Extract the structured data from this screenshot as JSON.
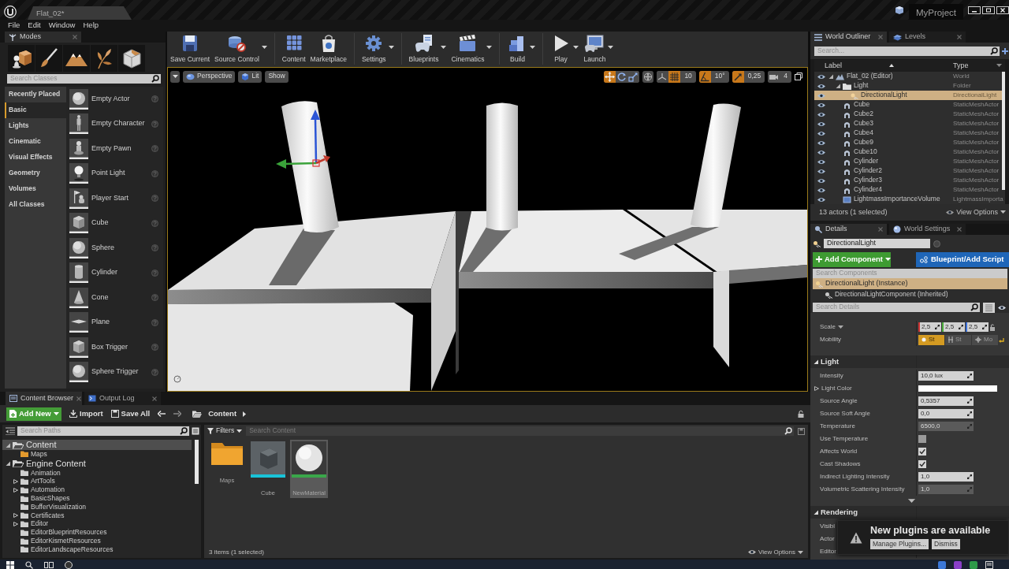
{
  "title_bar": {
    "tabs": [
      {
        "label": "Flat_02*",
        "selected": true
      }
    ],
    "project": "MyProject"
  },
  "menu_bar": [
    "File",
    "Edit",
    "Window",
    "Help"
  ],
  "modes_panel": {
    "tab": "Modes",
    "mode_tools": [
      {
        "kind": "place"
      },
      {
        "kind": "paint"
      },
      {
        "kind": "landscape"
      },
      {
        "kind": "foliage"
      },
      {
        "kind": "geometry"
      }
    ],
    "search": {
      "placeholder": "Search Classes"
    },
    "categories": [
      {
        "label": "Recently Placed",
        "selected": false
      },
      {
        "label": "Basic",
        "selected": true
      },
      {
        "label": "Lights",
        "selected": false
      },
      {
        "label": "Cinematic",
        "selected": false
      },
      {
        "label": "Visual Effects",
        "selected": false
      },
      {
        "label": "Geometry",
        "selected": false
      },
      {
        "label": "Volumes",
        "selected": false
      },
      {
        "label": "All Classes",
        "selected": false
      }
    ],
    "items": [
      {
        "label": "Empty Actor",
        "kind": "sphere"
      },
      {
        "label": "Empty Character",
        "kind": "character"
      },
      {
        "label": "Empty Pawn",
        "kind": "pawn"
      },
      {
        "label": "Point Light",
        "kind": "bulb"
      },
      {
        "label": "Player Start",
        "kind": "flag"
      },
      {
        "label": "Cube",
        "kind": "cube"
      },
      {
        "label": "Sphere",
        "kind": "sphere"
      },
      {
        "label": "Cylinder",
        "kind": "cylinder"
      },
      {
        "label": "Cone",
        "kind": "cone"
      },
      {
        "label": "Plane",
        "kind": "plane"
      },
      {
        "label": "Box Trigger",
        "kind": "cube"
      },
      {
        "label": "Sphere Trigger",
        "kind": "sphere"
      }
    ]
  },
  "toolbar": [
    {
      "label": "Save Current",
      "kind": "save",
      "dropdown": false
    },
    {
      "label": "Source Control",
      "kind": "source_control",
      "dropdown": true
    },
    {
      "label": "Content",
      "kind": "content",
      "dropdown": false
    },
    {
      "label": "Marketplace",
      "kind": "marketplace",
      "dropdown": false
    },
    {
      "label": "Settings",
      "kind": "settings",
      "dropdown": true
    },
    {
      "label": "Blueprints",
      "kind": "blueprints",
      "dropdown": true
    },
    {
      "label": "Cinematics",
      "kind": "cinematics",
      "dropdown": true
    },
    {
      "label": "Build",
      "kind": "build",
      "dropdown": true
    },
    {
      "label": "Play",
      "kind": "play",
      "dropdown": true
    },
    {
      "label": "Launch",
      "kind": "launch",
      "dropdown": true
    }
  ],
  "viewport": {
    "view_buttons": [
      {
        "label": "Perspective",
        "kind": "perspective"
      },
      {
        "label": "Lit",
        "kind": "lit"
      },
      {
        "label": "Show",
        "kind": "plain"
      }
    ],
    "transform_tools": [
      {
        "kind": "move",
        "selected": true
      },
      {
        "kind": "rotate",
        "selected": false
      },
      {
        "kind": "scale",
        "selected": false
      }
    ],
    "snaps": [
      {
        "kind": "grid",
        "on": true,
        "value": "10"
      },
      {
        "kind": "rotation",
        "on": true,
        "value": "10°"
      },
      {
        "kind": "scale",
        "on": true,
        "value": "0,25"
      }
    ],
    "camera_speed": "4"
  },
  "world_outliner": {
    "tabs": [
      {
        "label": "World Outliner",
        "selected": true
      },
      {
        "label": "Levels",
        "selected": false
      }
    ],
    "search": {
      "placeholder": "Search..."
    },
    "columns": [
      "Label",
      "Type"
    ],
    "rows": [
      {
        "label": "Flat_02 (Editor)",
        "type": "World",
        "kind": "world",
        "selected": false,
        "expanded": true,
        "children": [
          {
            "label": "Light",
            "type": "Folder",
            "kind": "folder",
            "selected": false,
            "expanded": true,
            "children": [
              {
                "label": "DirectionalLight",
                "type": "DirectionalLight",
                "kind": "light",
                "selected": true
              }
            ]
          },
          {
            "label": "Cube",
            "type": "StaticMeshActor",
            "kind": "mesh",
            "selected": false
          },
          {
            "label": "Cube2",
            "type": "StaticMeshActor",
            "kind": "mesh",
            "selected": false
          },
          {
            "label": "Cube3",
            "type": "StaticMeshActor",
            "kind": "mesh",
            "selected": false
          },
          {
            "label": "Cube4",
            "type": "StaticMeshActor",
            "kind": "mesh",
            "selected": false
          },
          {
            "label": "Cube9",
            "type": "StaticMeshActor",
            "kind": "mesh",
            "selected": false
          },
          {
            "label": "Cube10",
            "type": "StaticMeshActor",
            "kind": "mesh",
            "selected": false
          },
          {
            "label": "Cylinder",
            "type": "StaticMeshActor",
            "kind": "mesh",
            "selected": false
          },
          {
            "label": "Cylinder2",
            "type": "StaticMeshActor",
            "kind": "mesh",
            "selected": false
          },
          {
            "label": "Cylinder3",
            "type": "StaticMeshActor",
            "kind": "mesh",
            "selected": false
          },
          {
            "label": "Cylinder4",
            "type": "StaticMeshActor",
            "kind": "mesh",
            "selected": false
          },
          {
            "label": "LightmassImportanceVolume",
            "type": "LightmassImporta",
            "kind": "volume",
            "selected": false
          }
        ]
      }
    ],
    "footer": "13 actors (1 selected)",
    "view_options": "View Options"
  },
  "details": {
    "tabs": [
      {
        "label": "Details",
        "selected": true
      },
      {
        "label": "World Settings",
        "selected": false
      }
    ],
    "name": "DirectionalLight",
    "add_component": "Add Component",
    "blueprint_button": "Blueprint/Add Script",
    "components_search": {
      "placeholder": "Search Components"
    },
    "components": [
      {
        "label": "DirectionalLight (Instance)",
        "selected": true,
        "children": [
          {
            "label": "DirectionalLightComponent (Inherited)",
            "selected": false
          }
        ]
      }
    ],
    "details_search": {
      "placeholder": "Search Details"
    },
    "transform": [
      {
        "label": "Scale",
        "kind": "vector",
        "values": [
          "2,5",
          "2,5",
          "2,5"
        ]
      },
      {
        "label": "Mobility",
        "kind": "mobility",
        "options": [
          {
            "label": "St",
            "selected": true
          },
          {
            "label": "St",
            "selected": false
          },
          {
            "label": "Mo",
            "selected": false
          }
        ]
      }
    ],
    "sections": [
      {
        "title": "Light",
        "expanded": true,
        "rows": [
          {
            "label": "Intensity",
            "kind": "number",
            "value": "10,0 lux",
            "disabled": false
          },
          {
            "label": "Light Color",
            "kind": "color",
            "color": "#ffffff",
            "expanded": false
          },
          {
            "label": "Source Angle",
            "kind": "number",
            "value": "0,5357",
            "disabled": false
          },
          {
            "label": "Source Soft Angle",
            "kind": "number",
            "value": "0,0",
            "disabled": false
          },
          {
            "label": "Temperature",
            "kind": "number",
            "value": "6500,0",
            "disabled": true
          },
          {
            "label": "Use Temperature",
            "kind": "checkbox",
            "checked": false
          },
          {
            "label": "Affects World",
            "kind": "checkbox",
            "checked": true
          },
          {
            "label": "Cast Shadows",
            "kind": "checkbox",
            "checked": true
          },
          {
            "label": "Indirect Lighting Intensity",
            "kind": "number",
            "value": "1,0",
            "disabled": false
          },
          {
            "label": "Volumetric Scattering Intensity",
            "kind": "number",
            "value": "1,0",
            "disabled": true
          }
        ]
      },
      {
        "title": "Rendering",
        "expanded": true,
        "rows": [
          {
            "label": "Visibl"
          },
          {
            "label": "Actor"
          },
          {
            "label": "Editor"
          }
        ]
      }
    ]
  },
  "notification": {
    "title": "New plugins are available",
    "buttons": [
      "Manage Plugins...",
      "Dismiss"
    ]
  },
  "content_browser": {
    "tabs": [
      {
        "label": "Content Browser",
        "selected": true
      },
      {
        "label": "Output Log",
        "selected": false
      }
    ],
    "add_new": "Add New",
    "import": "Import",
    "save_all": "Save All",
    "path": [
      "Content"
    ],
    "sources_search": {
      "placeholder": "Search Paths"
    },
    "tree": [
      {
        "label": "Content",
        "selected": true,
        "expanded": true,
        "color": "#d6d6d6",
        "children": [
          {
            "label": "Maps",
            "selected": false,
            "color": "#e39a2d"
          }
        ]
      },
      {
        "label": "Engine Content",
        "selected": false,
        "expanded": true,
        "color": "#d6d6d6",
        "children": [
          {
            "label": "Animation",
            "selected": false,
            "color": "#cfcfcf"
          },
          {
            "label": "ArtTools",
            "selected": false,
            "expanded": false,
            "color": "#cfcfcf"
          },
          {
            "label": "Automation",
            "selected": false,
            "expanded": false,
            "color": "#cfcfcf"
          },
          {
            "label": "BasicShapes",
            "selected": false,
            "color": "#cfcfcf"
          },
          {
            "label": "BufferVisualization",
            "selected": false,
            "color": "#cfcfcf"
          },
          {
            "label": "Certificates",
            "selected": false,
            "expanded": false,
            "color": "#cfcfcf"
          },
          {
            "label": "Editor",
            "selected": false,
            "expanded": false,
            "color": "#cfcfcf"
          },
          {
            "label": "EditorBlueprintResources",
            "selected": false,
            "color": "#cfcfcf"
          },
          {
            "label": "EditorKismetResources",
            "selected": false,
            "color": "#cfcfcf"
          },
          {
            "label": "EditorLandscapeResources",
            "selected": false,
            "color": "#cfcfcf"
          }
        ]
      }
    ],
    "filters": "Filters",
    "assets_search": {
      "placeholder": "Search Content"
    },
    "assets": [
      {
        "label": "Maps",
        "kind": "folder",
        "selected": false
      },
      {
        "label": "Cube",
        "kind": "mesh",
        "selected": false
      },
      {
        "label": "NewMaterial",
        "kind": "material",
        "selected": true
      }
    ],
    "status": "3 items (1 selected)",
    "view_options": "View Options"
  }
}
